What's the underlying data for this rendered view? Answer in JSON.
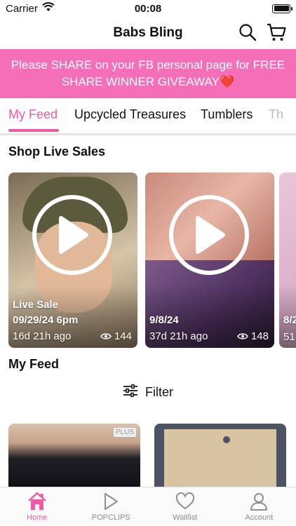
{
  "status_bar": {
    "carrier": "Carrier",
    "time": "00:08"
  },
  "header": {
    "title": "Babs Bling",
    "search_icon": "search-icon",
    "cart_icon": "cart-icon"
  },
  "banner": {
    "text": "Please SHARE on your FB personal page for FREE SHARE WINNER GIVEAWAY❤️"
  },
  "tabs": [
    {
      "label": "My Feed",
      "active": true
    },
    {
      "label": "Upcycled Treasures",
      "active": false
    },
    {
      "label": "Tumblers",
      "active": false
    },
    {
      "label": "Th",
      "active": false
    }
  ],
  "live_sales": {
    "title": "Shop Live Sales",
    "cards": [
      {
        "line1": "Live Sale",
        "line2": "09/29/24 6pm",
        "ago": "16d 21h ago",
        "views": "144"
      },
      {
        "line1": "",
        "line2": "9/8/24",
        "ago": "37d 21h ago",
        "views": "148"
      },
      {
        "line1": "",
        "line2": "8/2",
        "ago": "51",
        "views": ""
      }
    ]
  },
  "feed": {
    "title": "My Feed",
    "filter_label": "Filter",
    "plus_badge": "PLUS"
  },
  "tabbar": [
    {
      "label": "Home",
      "icon": "home-icon",
      "active": true
    },
    {
      "label": "POPCLIPS",
      "icon": "play-icon",
      "active": false
    },
    {
      "label": "Waitlist",
      "icon": "heart-icon",
      "active": false
    },
    {
      "label": "Account",
      "icon": "person-icon",
      "active": false
    }
  ],
  "colors": {
    "accent": "#ef5aa6",
    "banner": "#f56fb8"
  }
}
